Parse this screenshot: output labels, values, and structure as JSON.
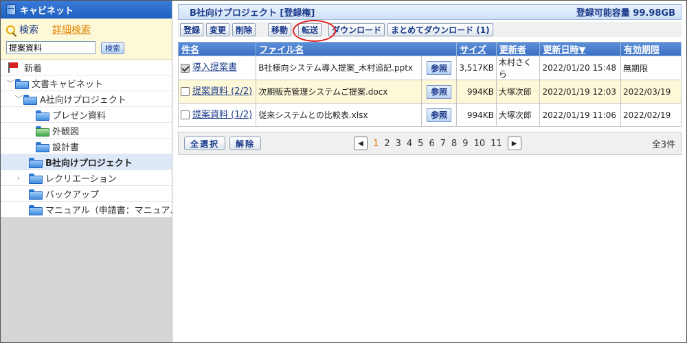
{
  "sidebar": {
    "title": "キャビネット",
    "search_link": "検索",
    "advanced_search_link": "詳細検索",
    "search_value": "提案資料",
    "search_button": "検索",
    "tree": [
      {
        "label": "新着",
        "type": "flag",
        "indent": 0
      },
      {
        "label": "文書キャビネット",
        "type": "folder",
        "chevron": "down"
      },
      {
        "label": "A社向けプロジェクト",
        "type": "folder",
        "chevron": "down"
      },
      {
        "label": "プレゼン資料",
        "type": "folder"
      },
      {
        "label": "外観図",
        "type": "folder-green"
      },
      {
        "label": "設計書",
        "type": "folder"
      },
      {
        "label": "B社向けプロジェクト",
        "type": "folder",
        "selected": true
      },
      {
        "label": "レクリエーション",
        "type": "folder",
        "chevron": "right"
      },
      {
        "label": "バックアップ",
        "type": "folder"
      },
      {
        "label": "マニュアル（申請書：マニュアル登",
        "type": "folder"
      }
    ]
  },
  "main": {
    "title": "B社向けプロジェクト [登録権]",
    "quota": "登録可能容量 99.98GB",
    "toolbar": {
      "register": "登録",
      "modify": "変更",
      "delete": "削除",
      "move": "移動",
      "transfer": "転送",
      "download": "ダウンロード",
      "bulk_download": "まとめてダウンロード (1)"
    },
    "columns": {
      "subject": "件名",
      "filename": "ファイル名",
      "size": "サイズ",
      "updater": "更新者",
      "updated": "更新日時▼",
      "expiry": "有効期限"
    },
    "rows": [
      {
        "subject": "導入提案書",
        "filename": "B社様向システム導入提案_木村追記.pptx",
        "ref": "参照",
        "size": "3,517KB",
        "updater": "木村さくら",
        "updated": "2022/01/20 15:48",
        "expiry": "無期限",
        "checked": true
      },
      {
        "subject": "提案資料 (2/2)",
        "filename": "次期販売管理システムご提案.docx",
        "ref": "参照",
        "size": "994KB",
        "updater": "大塚次郎",
        "updated": "2022/01/19 12:03",
        "expiry": "2022/03/19",
        "checked": false
      },
      {
        "subject": "提案資料 (1/2)",
        "filename": "従来システムとの比較表.xlsx",
        "ref": "参照",
        "size": "994KB",
        "updater": "大塚次郎",
        "updated": "2022/01/19 11:06",
        "expiry": "2022/02/19",
        "checked": false
      }
    ],
    "footer": {
      "select_all": "全選択",
      "deselect": "解除",
      "pages": [
        "1",
        "2",
        "3",
        "4",
        "5",
        "6",
        "7",
        "8",
        "9",
        "10",
        "11"
      ],
      "current_page": "1",
      "total": "全3件"
    }
  }
}
